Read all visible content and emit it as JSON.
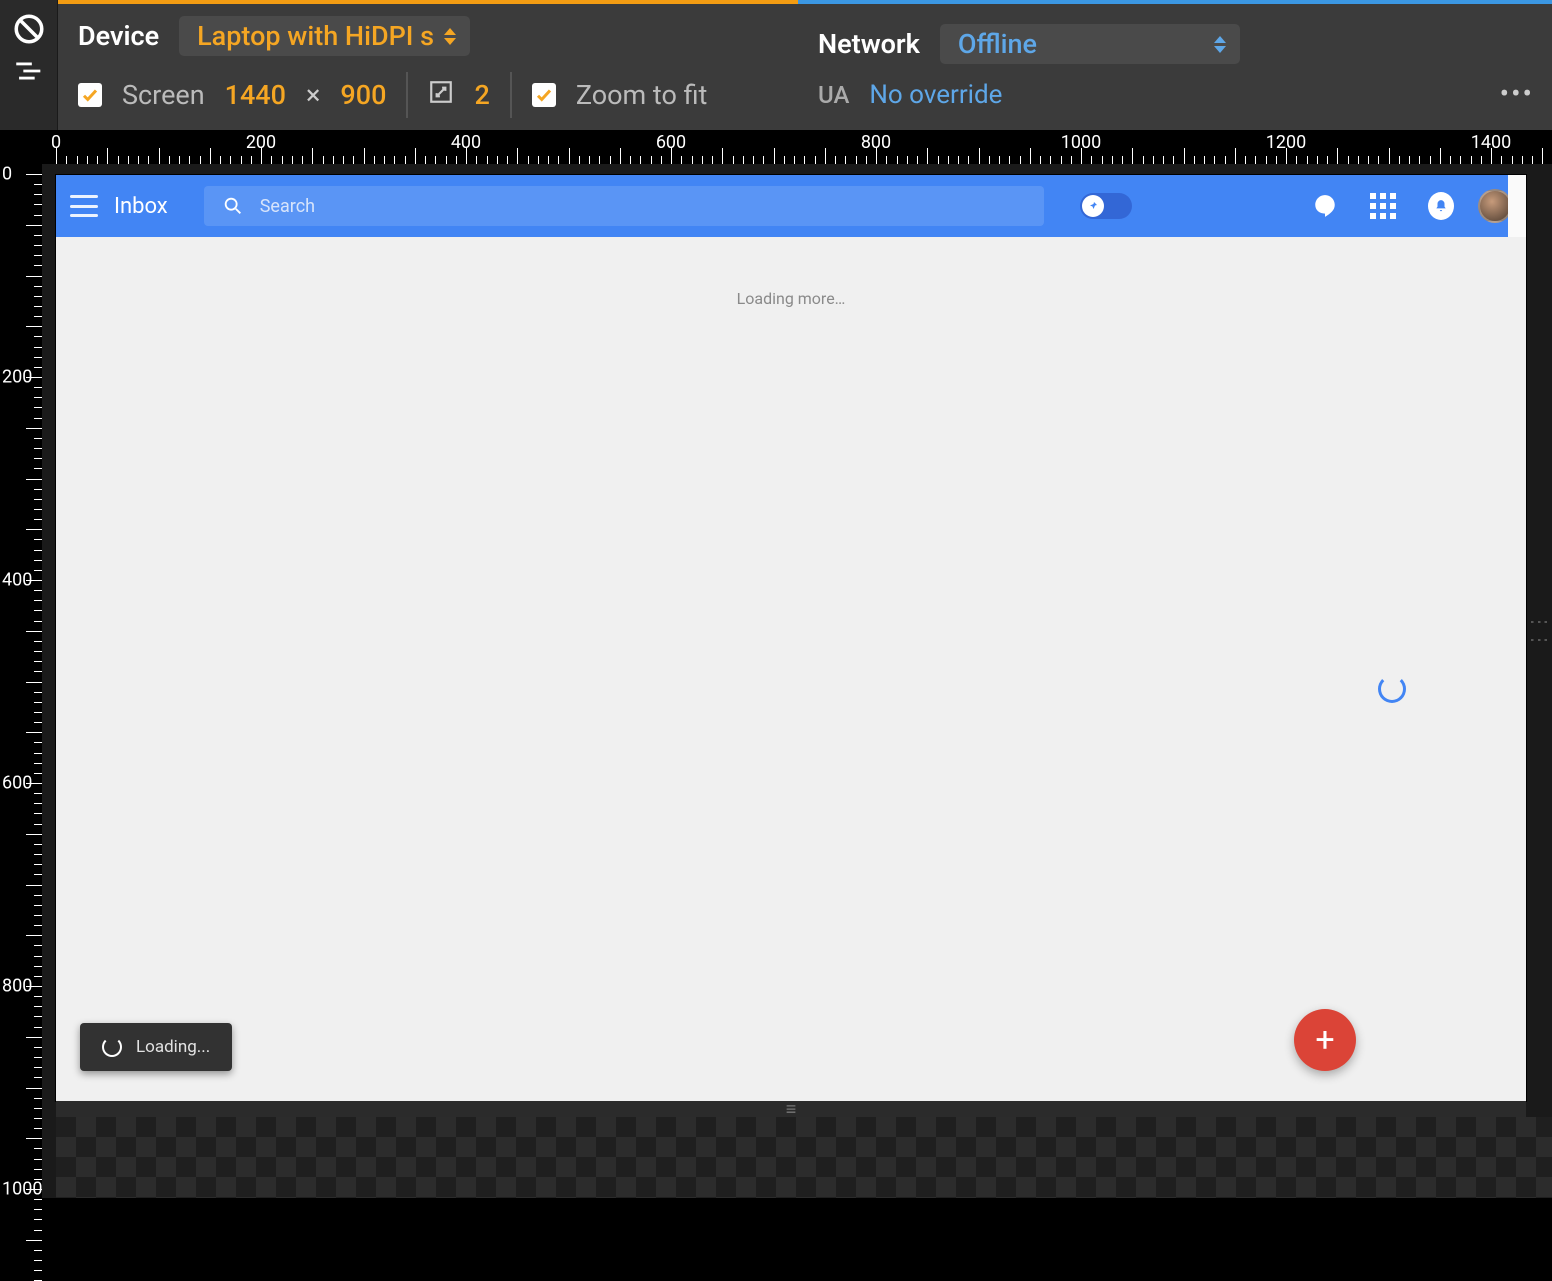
{
  "devtools": {
    "device_label": "Device",
    "device_value": "Laptop with HiDPI s",
    "network_label": "Network",
    "network_value": "Offline",
    "screen_label": "Screen",
    "width": "1440",
    "height": "900",
    "dpr": "2",
    "zoom_label": "Zoom to fit",
    "ua_label": "UA",
    "ua_value": "No override"
  },
  "ruler": {
    "h": [
      "0",
      "200",
      "400",
      "600",
      "800",
      "1000",
      "1200",
      "1400"
    ],
    "v": [
      "0",
      "200",
      "400",
      "600",
      "800",
      "1000"
    ]
  },
  "inbox": {
    "title": "Inbox",
    "search_placeholder": "Search",
    "loading_more": "Loading more…",
    "toast": "Loading...",
    "fab": "+"
  }
}
